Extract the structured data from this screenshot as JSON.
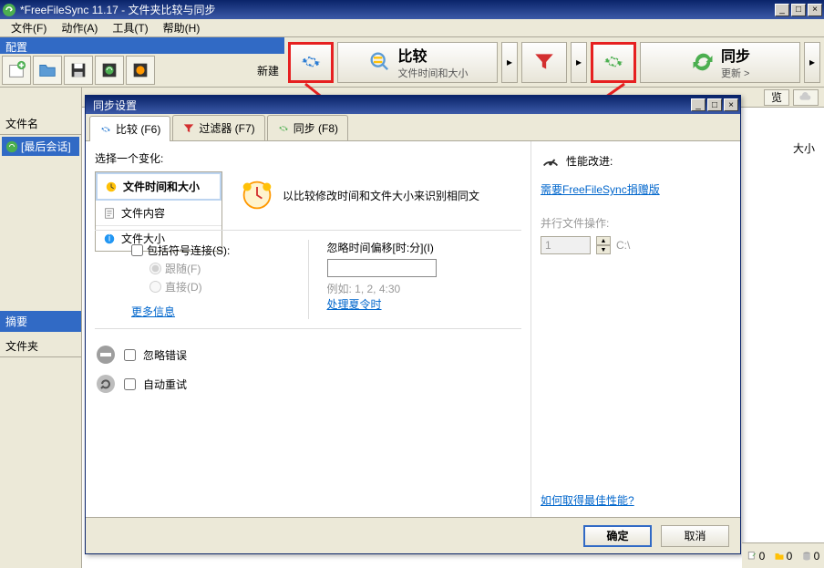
{
  "window": {
    "title": "*FreeFileSync 11.17 - 文件夹比较与同步"
  },
  "menu": {
    "file": "文件(F)",
    "action": "动作(A)",
    "tools": "工具(T)",
    "help": "帮助(H)"
  },
  "config": {
    "label": "配置",
    "new_label": "新建"
  },
  "toolbar": {
    "compare_label": "比较",
    "compare_sub": "文件时间和大小",
    "sync_label": "同步",
    "sync_sub": "更新 >"
  },
  "left_panel": {
    "filename": "文件名",
    "session": "[最后会话]",
    "summary": "摘要",
    "folder": "文件夹"
  },
  "right_bar": {
    "browse": "览",
    "size": "大小"
  },
  "dialog": {
    "title": "同步设置",
    "tabs": {
      "compare": "比较 (F6)",
      "filter": "过滤器 (F7)",
      "sync": "同步 (F8)"
    },
    "select_change": "选择一个变化:",
    "options": {
      "time_size": "文件时间和大小",
      "content": "文件内容",
      "size": "文件大小"
    },
    "description": "以比较修改时间和文件大小来识别相同文",
    "symlinks": {
      "include": "包括符号连接(S):",
      "follow": "跟随(F)",
      "direct": "直接(D)"
    },
    "more_info": "更多信息",
    "time_offset": {
      "label": "忽略时间偏移[时:分](I)",
      "example": "例如: 1, 2, 4:30",
      "dst": "处理夏令时"
    },
    "ignore_errors": "忽略错误",
    "auto_retry": "自动重试",
    "performance": {
      "label": "性能改进:",
      "donate_link": "需要FreeFileSync捐赠版",
      "parallel": "并行文件操作:",
      "parallel_value": "1",
      "path": "C:\\",
      "best_perf": "如何取得最佳性能?"
    },
    "ok": "确定",
    "cancel": "取消"
  },
  "statusbar": {
    "count1": "0",
    "count2": "0",
    "count3": "0"
  }
}
